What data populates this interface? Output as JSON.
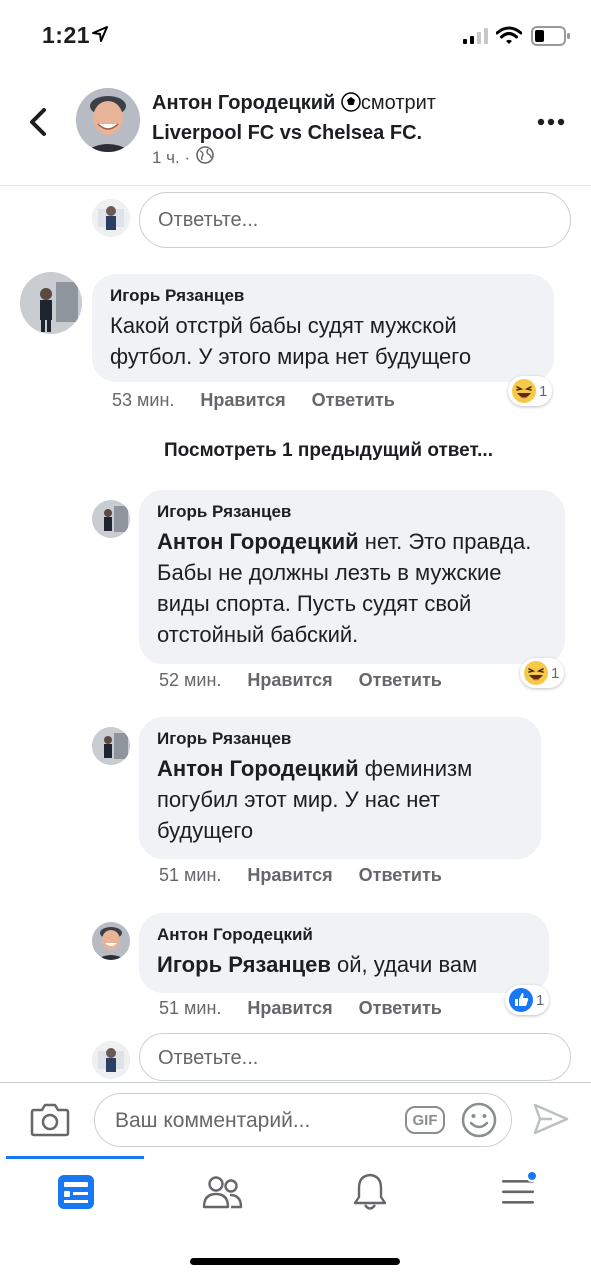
{
  "status": {
    "time": "1:21"
  },
  "header": {
    "name": "Антон Городецкий",
    "activity": "смотрит",
    "match": "Liverpool FC vs Chelsea FC",
    "meta_time": "1 ч. ·"
  },
  "reply_top": {
    "placeholder": "Ответьте..."
  },
  "comment_main": {
    "author": "Игорь Рязанцев",
    "text": "Какой отстрй бабы судят мужской футбол. У этого мира нет будущего",
    "time": "53 мин.",
    "like": "Нравится",
    "reply": "Ответить",
    "reaction_count": "1"
  },
  "view_previous": "Посмотреть 1 предыдущий ответ...",
  "replies": [
    {
      "author": "Игорь Рязанцев",
      "mention": "Антон Городецкий",
      "text": " нет. Это правда. Бабы не должны лезть в мужские виды спорта. Пусть судят свой отстойный бабский.",
      "time": "52 мин.",
      "like": "Нравится",
      "reply": "Ответить",
      "reaction_count": "1"
    },
    {
      "author": "Игорь Рязанцев",
      "mention": "Антон Городецкий",
      "text": " феминизм погубил этот мир. У нас нет будущего",
      "time": "51 мин.",
      "like": "Нравится",
      "reply": "Ответить"
    },
    {
      "author": "Антон Городецкий",
      "mention": "Игорь Рязанцев",
      "text": " ой, удачи вам",
      "time": "51 мин.",
      "like": "Нравится",
      "reply": "Ответить",
      "reaction_count": "1"
    }
  ],
  "reply_bottom": {
    "placeholder": "Ответьте..."
  },
  "composer": {
    "placeholder": "Ваш комментарий...",
    "gif_label": "GIF"
  },
  "tabs": [
    "news-feed",
    "friends",
    "notifications",
    "menu"
  ],
  "colors": {
    "accent": "#1877f2",
    "bubble": "#f0f2f5",
    "muted": "#65676b"
  }
}
